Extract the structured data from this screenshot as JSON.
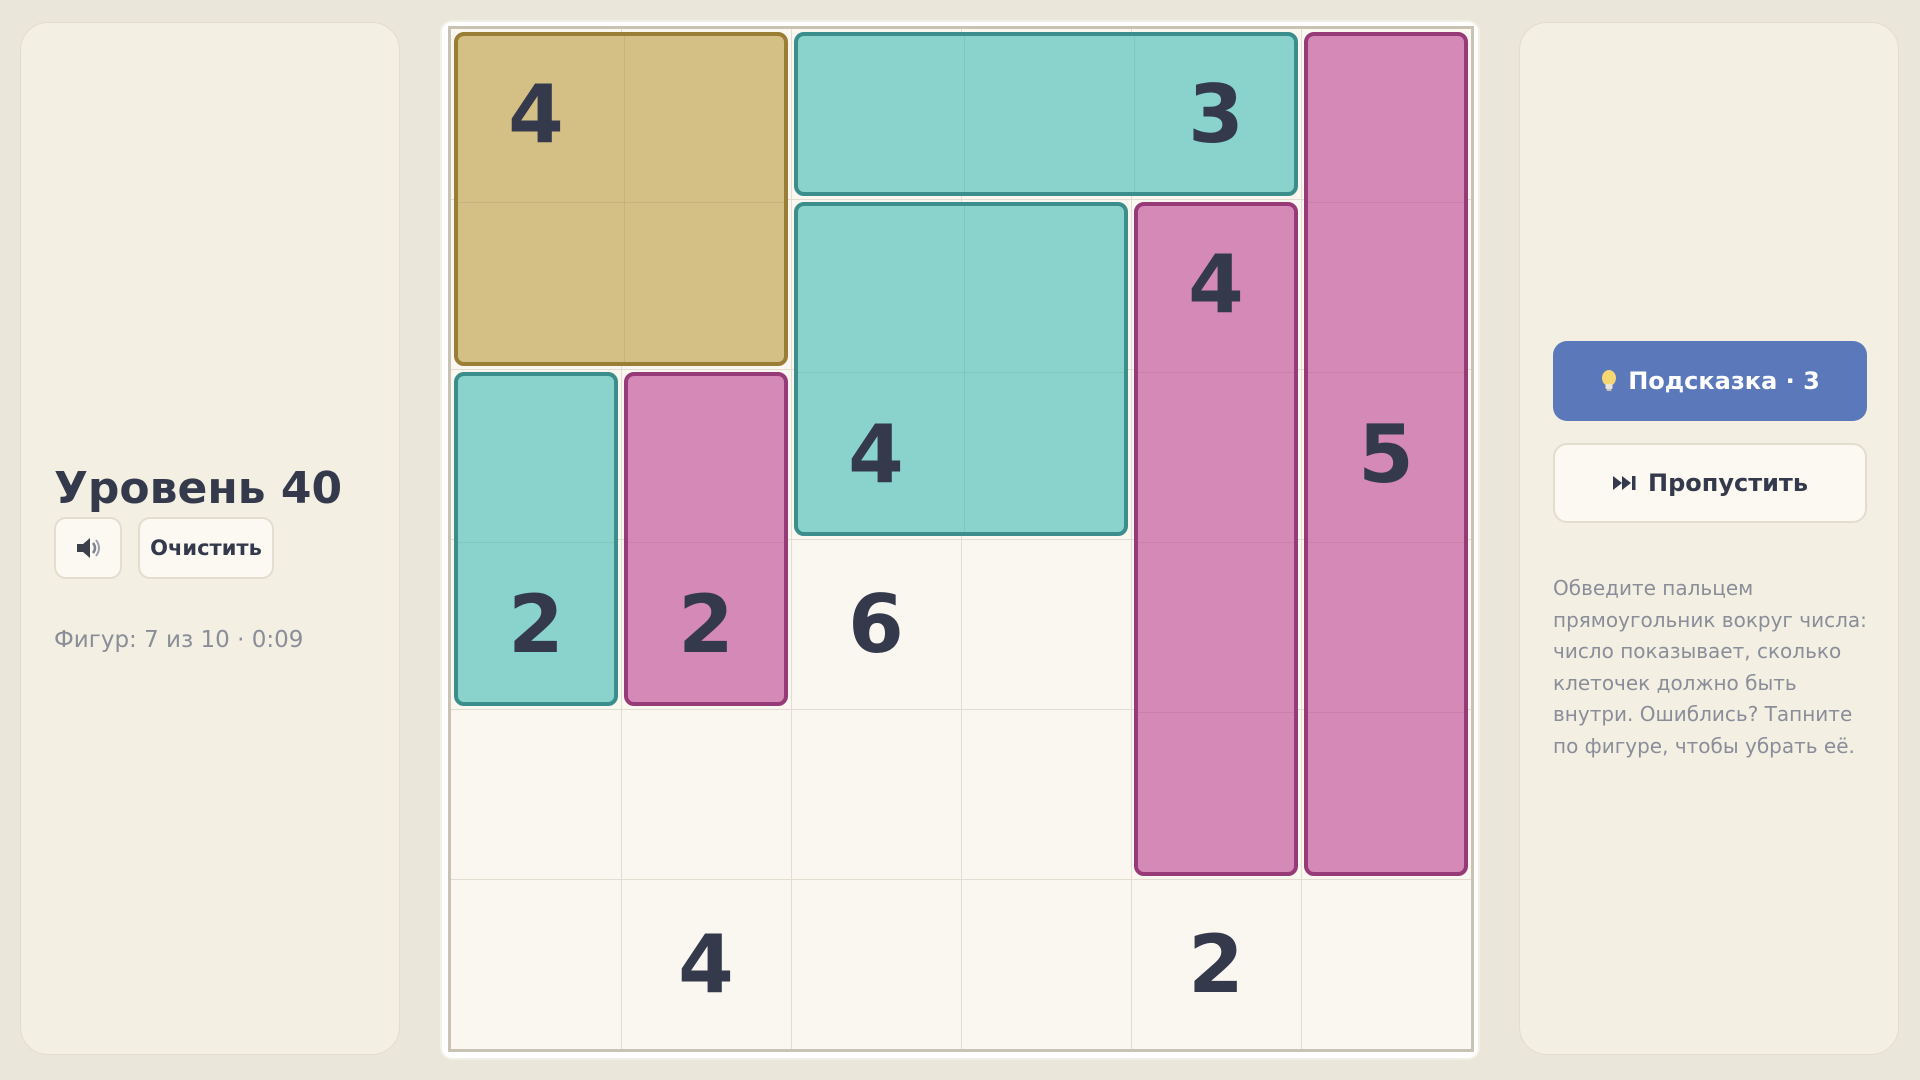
{
  "left_panel": {
    "level_title": "Уровень 40",
    "sound_icon": "speaker-icon",
    "clear_label": "Очистить",
    "status": "Фигур: 7 из 10 · 0:09"
  },
  "right_panel": {
    "hint_icon": "lightbulb-icon",
    "hint_label": "Подсказка · 3",
    "skip_icon": "skip-forward-icon",
    "skip_label": "Пропустить",
    "help_text": "Обведите пальцем прямоугольник вокруг числа: число показывает, сколько клеточек должно быть внутри. Ошиблись? Тапните по фигуре, чтобы убрать её."
  },
  "board": {
    "rows": 6,
    "cols": 6,
    "clues": [
      {
        "row": 0,
        "col": 0,
        "value": "4"
      },
      {
        "row": 0,
        "col": 4,
        "value": "3"
      },
      {
        "row": 1,
        "col": 4,
        "value": "4"
      },
      {
        "row": 2,
        "col": 2,
        "value": "4"
      },
      {
        "row": 2,
        "col": 5,
        "value": "5"
      },
      {
        "row": 3,
        "col": 0,
        "value": "2"
      },
      {
        "row": 3,
        "col": 1,
        "value": "2"
      },
      {
        "row": 3,
        "col": 2,
        "value": "6"
      },
      {
        "row": 5,
        "col": 1,
        "value": "4"
      },
      {
        "row": 5,
        "col": 4,
        "value": "2"
      }
    ],
    "shapes": [
      {
        "row": 0,
        "col": 0,
        "rows": 2,
        "cols": 2,
        "color": "gold"
      },
      {
        "row": 0,
        "col": 2,
        "rows": 1,
        "cols": 3,
        "color": "teal"
      },
      {
        "row": 0,
        "col": 5,
        "rows": 5,
        "cols": 1,
        "color": "pink"
      },
      {
        "row": 1,
        "col": 2,
        "rows": 2,
        "cols": 2,
        "color": "teal"
      },
      {
        "row": 1,
        "col": 4,
        "rows": 4,
        "cols": 1,
        "color": "pink"
      },
      {
        "row": 2,
        "col": 0,
        "rows": 2,
        "cols": 1,
        "color": "teal"
      },
      {
        "row": 2,
        "col": 1,
        "rows": 2,
        "cols": 1,
        "color": "pink"
      }
    ],
    "palette": {
      "gold": {
        "fill": "#d4c084",
        "border": "#9a7e36"
      },
      "teal": {
        "fill": "#8ad3cd",
        "border": "#3b8e8b"
      },
      "pink": {
        "fill": "#d589b7",
        "border": "#973a78"
      }
    }
  }
}
